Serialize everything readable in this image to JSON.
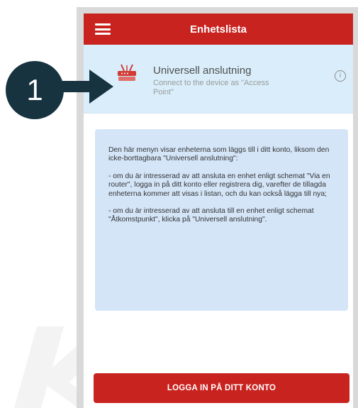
{
  "header": {
    "title": "Enhetslista"
  },
  "device": {
    "title": "Universell anslutning",
    "subtitle": "Connect to the device as \"Access Point\""
  },
  "info": {
    "paragraphs": [
      "Den här menyn visar enheterna som läggs till i ditt konto, liksom den icke-borttagbara \"Universell anslutning\":",
      "- om du är intresserad av att ansluta en enhet enligt schemat \"Via en router\", logga in på ditt konto eller registrera dig, varefter de tillagda enheterna kommer att visas i listan, och du kan också lägga till nya;",
      "- om du är intresserad av att ansluta till en enhet enligt schemat \"Åtkomstpunkt\", klicka på \"Universell anslutning\"."
    ]
  },
  "login_button": {
    "label": "LOGGA IN PÅ DITT KONTO"
  },
  "callout": {
    "number": "1"
  },
  "colors": {
    "header": "#c8231f",
    "device_row_bg": "#d9eefa",
    "info_box_bg": "#d4e5f8",
    "callout_bg": "#16333f"
  }
}
